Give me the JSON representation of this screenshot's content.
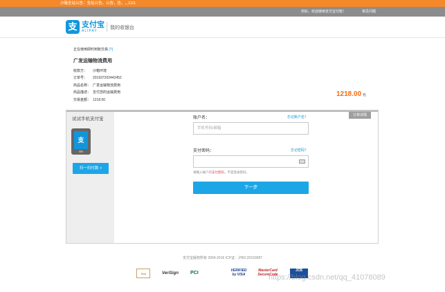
{
  "notice": {
    "text": "沙箱全站公告：全站公告，公告，告，,,,1111"
  },
  "topbar": {
    "greeting": "你好，欢迎使用支付宝付款！",
    "faq": "常见问题"
  },
  "header": {
    "logo_cn": "支付宝",
    "logo_en": "ALIPAY",
    "cashier": "我的收银台"
  },
  "order": {
    "using_text": "正在使用即时到账交易",
    "help": "[?]",
    "title": "广发运输物流费用",
    "rows": [
      {
        "label": "收款方：",
        "value": "沙箱环境"
      },
      {
        "label": "订单号：",
        "value": "201937202442452"
      },
      {
        "label": "商品名称：",
        "value": "广发运输物流费用"
      },
      {
        "label": "商品描述：",
        "value": "支付您的运输费用"
      },
      {
        "label": "交易金额：",
        "value": "1218.00"
      }
    ],
    "amount": "1218.00",
    "unit": "元",
    "details_tab": "订单详情"
  },
  "mobile": {
    "title": "试试手机支付宝",
    "scan_button": "扫一扫付款 >"
  },
  "form": {
    "account_label": "账户名：",
    "forgot_account": "忘记账户名？",
    "account_placeholder": "手机号码/邮箱",
    "password_label": "支付密码：",
    "forgot_password": "忘记密码？",
    "hint_prefix": "请输入账户的",
    "hint_red": "支付密码",
    "hint_suffix": "，不是登录密码。",
    "submit": "下一步"
  },
  "footer": {
    "copyright": "支付宝版权所有 2004-2016 ICP证：沪B2-20150087",
    "badges": [
      "Trust",
      "VeriSign",
      "PCI",
      "VERIFIED by VISA",
      "MasterCard SecureCode",
      "JCB"
    ]
  },
  "watermark": "https://blog.csdn.net/qq_41078089",
  "colors": {
    "accent": "#1da6e6",
    "amount": "#f56c12",
    "notice": "#f5892a"
  }
}
